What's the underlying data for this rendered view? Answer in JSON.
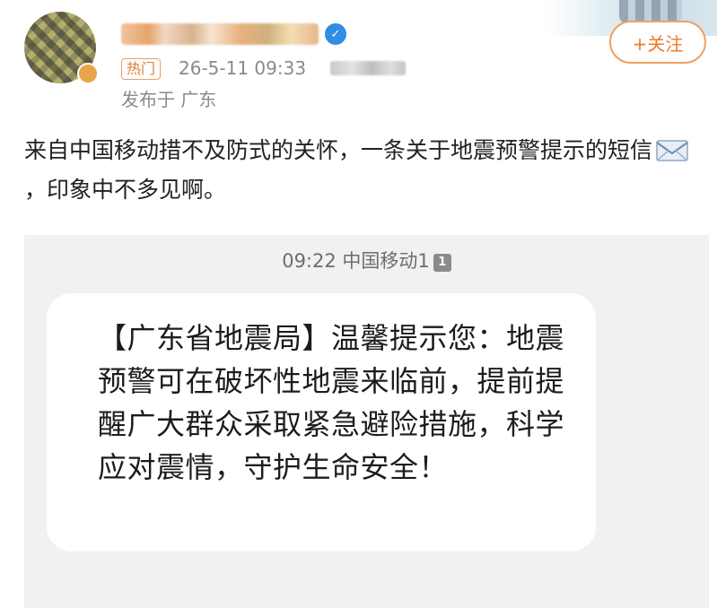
{
  "post": {
    "tag": "热门",
    "timestamp": "26-5-11 09:33",
    "location": "发布于 广东",
    "follow_label": "+关注",
    "text_part1": "来自中国移动措不及防式的关怀，一条关于地震预警提示的短信",
    "text_part2": "，印象中不多见啊。"
  },
  "sms": {
    "time": "09:22",
    "carrier": "中国移动1",
    "sim_number": "1",
    "message": "【广东省地震局】温馨提示您：地震预警可在破坏性地震来临前，提前提醒广大群众采取紧急避险措施，科学应对震情，守护生命安全！"
  },
  "icons": {
    "verify": "verified-badge-icon",
    "envelope": "envelope-icon"
  },
  "colors": {
    "accent": "#ef7b2a",
    "meta_text": "#8a8a8a",
    "sms_bg": "#f1f1f1"
  }
}
